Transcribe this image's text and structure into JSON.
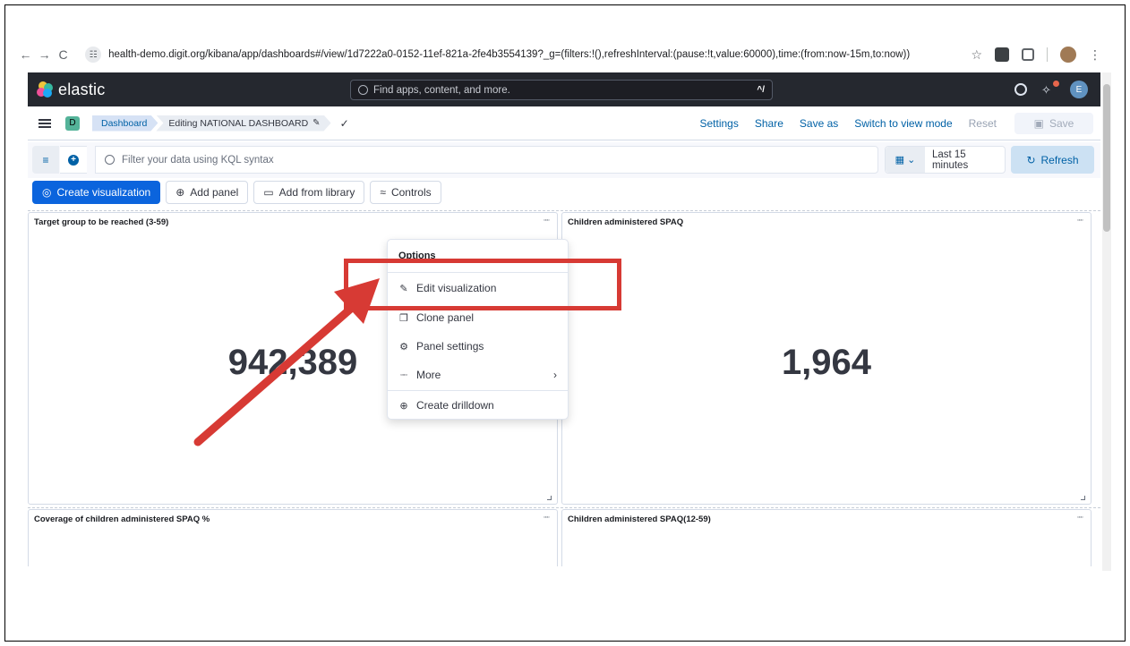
{
  "browser": {
    "url": "health-demo.digit.org/kibana/app/dashboards#/view/1d7222a0-0152-11ef-821a-2fe4b3554139?_g=(filters:!(),refreshInterval:(pause:!t,value:60000),time:(from:now-15m,to:now))",
    "back_glyph": "←",
    "forward_glyph": "→",
    "reload_glyph": "C",
    "star_glyph": "☆",
    "menu_glyph": "⋮",
    "settings_glyph": "☷"
  },
  "header": {
    "logo_text": "elastic",
    "search_placeholder": "Find apps, content, and more.",
    "search_shortcut": "^/",
    "avatar_letter": "E",
    "colors": {
      "bg": "#25282f",
      "avatar": "#6092c0"
    }
  },
  "subheader": {
    "space_letter": "D",
    "crumb_dashboard": "Dashboard",
    "crumb_editing": "Editing NATIONAL DASHBOARD",
    "pencil_glyph": "✎",
    "check_glyph": "✓",
    "settings": "Settings",
    "share": "Share",
    "save_as": "Save as",
    "switch_view": "Switch to view mode",
    "reset": "Reset",
    "save": "Save"
  },
  "query": {
    "placeholder": "Filter your data using KQL syntax",
    "time_range": "Last 15 minutes",
    "refresh": "Refresh",
    "filter_glyph": "≡",
    "plus_glyph": "+",
    "calendar_glyph": "▦ ⌄",
    "refresh_glyph": "↻"
  },
  "toolbar": {
    "create_visualization": "Create visualization",
    "add_panel": "Add panel",
    "add_from_library": "Add from library",
    "controls": "Controls",
    "create_glyph": "◎",
    "add_panel_glyph": "⊕",
    "library_glyph": "▭",
    "controls_glyph": "≈"
  },
  "panels": [
    {
      "title": "Target group to be reached (3-59)",
      "value": "942,389"
    },
    {
      "title": "Children administered SPAQ",
      "value": "1,964"
    },
    {
      "title": "Coverage of children administered SPAQ %",
      "value": ""
    },
    {
      "title": "Children administered SPAQ(12-59)",
      "value": ""
    }
  ],
  "panel_options_glyph": "▫▫▫",
  "context_menu": {
    "title": "Options",
    "items": [
      {
        "label": "Edit visualization",
        "icon": "✎"
      },
      {
        "label": "Clone panel",
        "icon": "❐"
      },
      {
        "label": "Panel settings",
        "icon": "⚙"
      },
      {
        "label": "More",
        "icon": "▫▫▫",
        "chevron": "›"
      },
      {
        "label": "Create drilldown",
        "icon": "⊕"
      }
    ]
  },
  "annotation": {
    "color": "#d73a34"
  }
}
